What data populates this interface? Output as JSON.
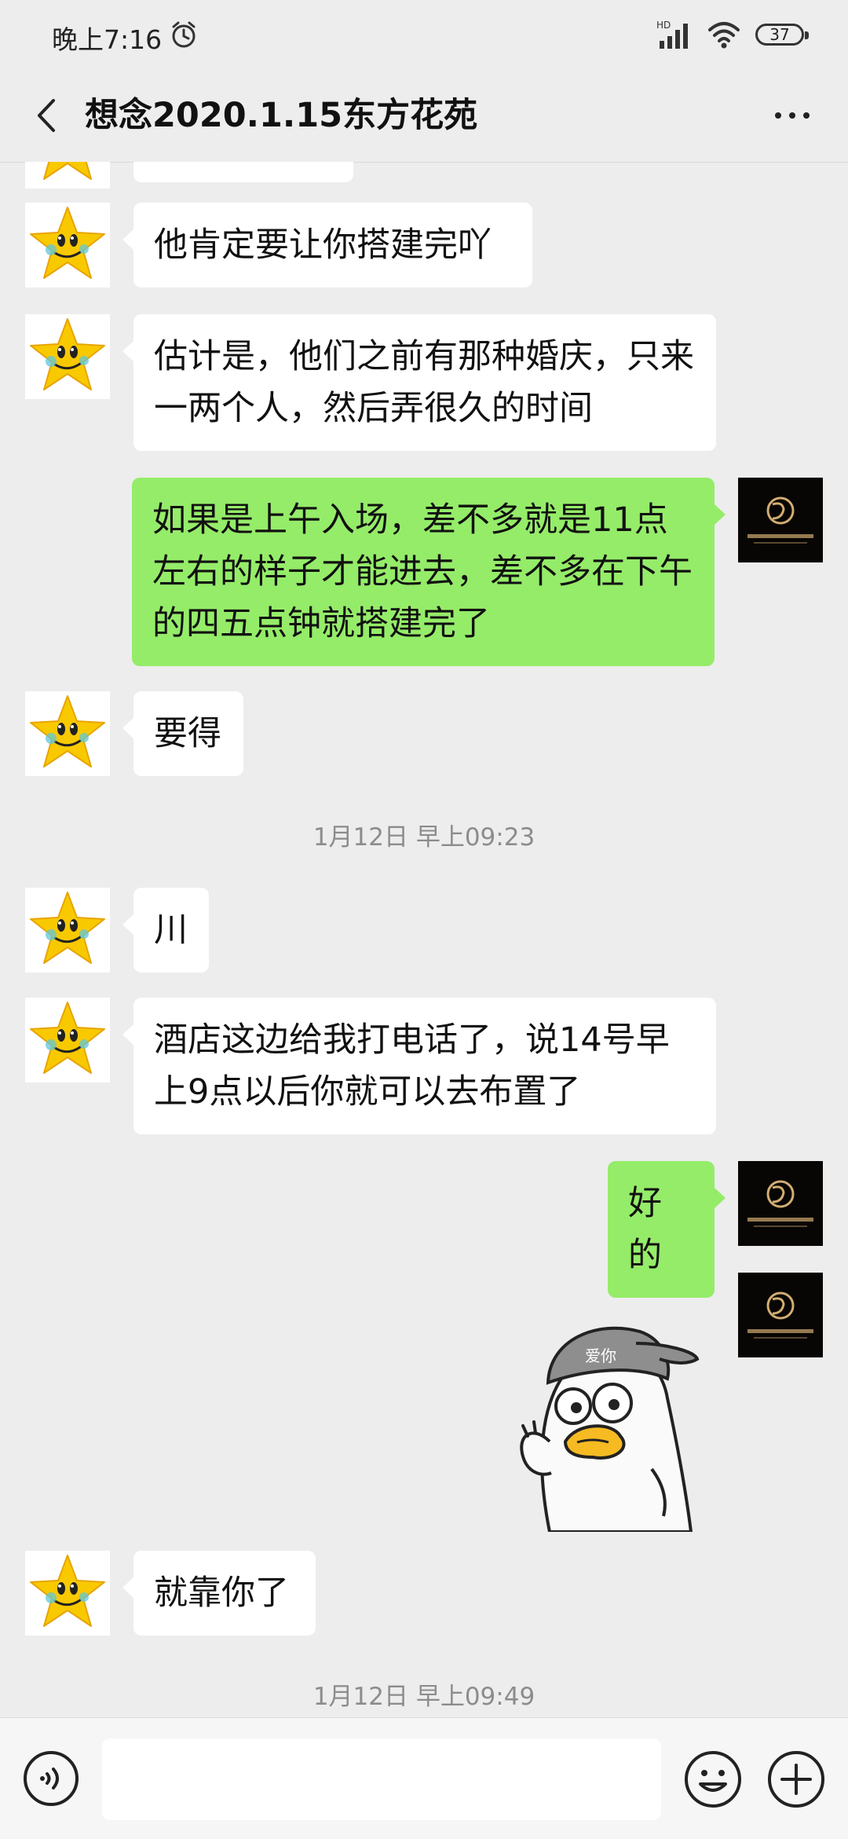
{
  "status_bar": {
    "time": "晚上7:16",
    "battery": "37",
    "network": "HD"
  },
  "header": {
    "title": "想念2020.1.15东方花苑"
  },
  "messages": [
    {
      "side": "left",
      "text": "他肯定要让你搭建完吖"
    },
    {
      "side": "left",
      "text": "估计是，他们之前有那种婚庆，只来一两个人，然后弄很久的时间"
    },
    {
      "side": "right",
      "text": "如果是上午入场，差不多就是11点左右的样子才能进去，差不多在下午的四五点钟就搭建完了"
    },
    {
      "side": "left",
      "text": "要得"
    },
    {
      "type": "timestamp",
      "text": "1月12日 早上09:23"
    },
    {
      "side": "left",
      "text": "川"
    },
    {
      "side": "left",
      "text": "酒店这边给我打电话了，说14号早上9点以后你就可以去布置了"
    },
    {
      "side": "right",
      "text": "好的"
    },
    {
      "side": "right",
      "type": "sticker",
      "sticker_text": "爱你"
    },
    {
      "side": "left",
      "text": "就靠你了"
    },
    {
      "type": "timestamp",
      "text": "1月12日 早上09:49"
    }
  ],
  "input_bar": {
    "placeholder": ""
  }
}
